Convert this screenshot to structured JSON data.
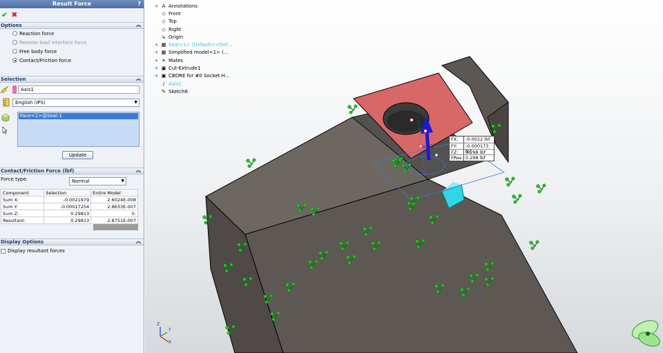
{
  "panel": {
    "title": "Result Force",
    "help": "?",
    "ok_icon": "check-icon",
    "cancel_icon": "x-icon",
    "options": {
      "header": "Options",
      "items": [
        {
          "label": "Reaction force",
          "selected": false,
          "enabled": true
        },
        {
          "label": "Remote load interface force",
          "selected": false,
          "enabled": false
        },
        {
          "label": "Free body force",
          "selected": false,
          "enabled": true
        },
        {
          "label": "Contact/Friction force",
          "selected": true,
          "enabled": true
        }
      ]
    },
    "selection": {
      "header": "Selection",
      "axis_value": "Axis1",
      "units_value": "English (IPS)",
      "faces": [
        "Face<1>@Seal-1"
      ],
      "update_label": "Update"
    },
    "contact": {
      "header": "Contact/Friction Force (lbf)",
      "force_type_label": "Force type:",
      "force_type_value": "Normal",
      "table": {
        "headers": [
          "Component",
          "Selection",
          "Entire Model"
        ],
        "rows": [
          [
            "Sum X:",
            "-0.0021979",
            "2.6024E-008"
          ],
          [
            "Sum Y:",
            "-0.00017254",
            "2.8633E-007"
          ],
          [
            "Sum Z:",
            "0.29813",
            "0."
          ],
          [
            "Resultant:",
            "0.29813",
            "2.8751E-007"
          ]
        ]
      }
    },
    "display": {
      "header": "Display Options",
      "checkbox_label": "Display resultant forces",
      "checked": false
    }
  },
  "tree": [
    {
      "label": "Annotations",
      "expander": "+",
      "icon": "A",
      "highlight": false
    },
    {
      "label": "Front",
      "expander": "",
      "icon": "◇",
      "highlight": false
    },
    {
      "label": "Top",
      "expander": "",
      "icon": "◇",
      "highlight": false
    },
    {
      "label": "Right",
      "expander": "",
      "icon": "◇",
      "highlight": false
    },
    {
      "label": "Origin",
      "expander": "",
      "icon": "↳",
      "highlight": false
    },
    {
      "label": "Seal<1> (Default<<Def...",
      "expander": "+",
      "icon": "▦",
      "highlight": true
    },
    {
      "label": "Simplified model<1> (...",
      "expander": "+",
      "icon": "▦",
      "highlight": false
    },
    {
      "label": "Mates",
      "expander": "+",
      "icon": "⚭",
      "highlight": false
    },
    {
      "label": "Cut-Extrude1",
      "expander": "+",
      "icon": "▣",
      "highlight": false
    },
    {
      "label": "CBORE for #0 Socket H...",
      "expander": "+",
      "icon": "▣",
      "highlight": false
    },
    {
      "label": "Axis1",
      "expander": "",
      "icon": "/",
      "highlight": true
    },
    {
      "label": "Sketch6",
      "expander": "",
      "icon": "✎",
      "highlight": false
    }
  ],
  "callout": [
    {
      "k": "FX:",
      "v": "-0.0022 lbf"
    },
    {
      "k": "FY:",
      "v": "-0.000173 lbf"
    },
    {
      "k": "FZ:",
      "v": "0.298 lbf"
    },
    {
      "k": "FRes:",
      "v": "0.298 lbf"
    }
  ],
  "axis_label": "Axis1",
  "triad": {
    "x": "X",
    "y": "Y",
    "z": "Z"
  },
  "colors": {
    "body": "#605a56",
    "seal_face": "#d86868",
    "fixture": "#22c422",
    "force_arrow": "#1a1ad8",
    "cyan_part": "#2fd7e6"
  }
}
